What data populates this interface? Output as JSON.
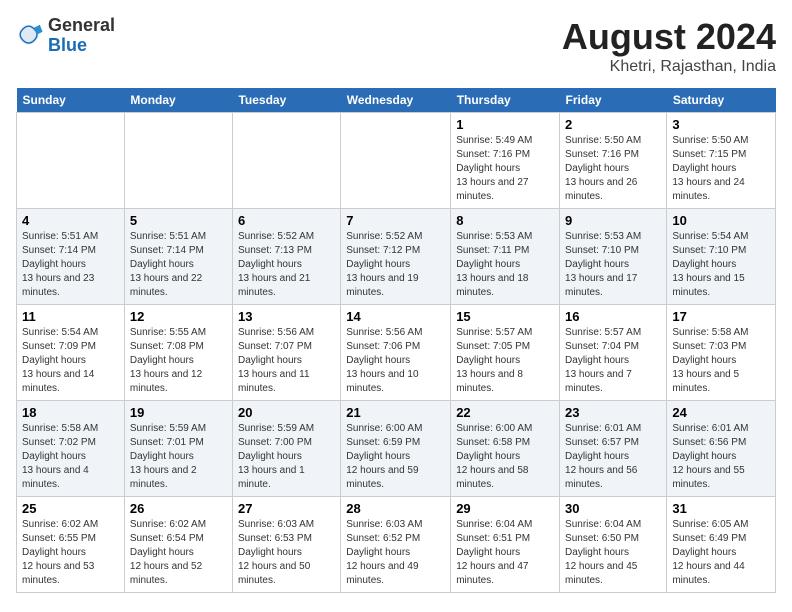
{
  "logo": {
    "general": "General",
    "blue": "Blue"
  },
  "title": "August 2024",
  "subtitle": "Khetri, Rajasthan, India",
  "days_of_week": [
    "Sunday",
    "Monday",
    "Tuesday",
    "Wednesday",
    "Thursday",
    "Friday",
    "Saturday"
  ],
  "weeks": [
    {
      "cells": [
        {
          "day": null
        },
        {
          "day": null
        },
        {
          "day": null
        },
        {
          "day": null
        },
        {
          "day": 1,
          "sunrise": "5:49 AM",
          "sunset": "7:16 PM",
          "daylight": "13 hours and 27 minutes."
        },
        {
          "day": 2,
          "sunrise": "5:50 AM",
          "sunset": "7:16 PM",
          "daylight": "13 hours and 26 minutes."
        },
        {
          "day": 3,
          "sunrise": "5:50 AM",
          "sunset": "7:15 PM",
          "daylight": "13 hours and 24 minutes."
        }
      ]
    },
    {
      "cells": [
        {
          "day": 4,
          "sunrise": "5:51 AM",
          "sunset": "7:14 PM",
          "daylight": "13 hours and 23 minutes."
        },
        {
          "day": 5,
          "sunrise": "5:51 AM",
          "sunset": "7:14 PM",
          "daylight": "13 hours and 22 minutes."
        },
        {
          "day": 6,
          "sunrise": "5:52 AM",
          "sunset": "7:13 PM",
          "daylight": "13 hours and 21 minutes."
        },
        {
          "day": 7,
          "sunrise": "5:52 AM",
          "sunset": "7:12 PM",
          "daylight": "13 hours and 19 minutes."
        },
        {
          "day": 8,
          "sunrise": "5:53 AM",
          "sunset": "7:11 PM",
          "daylight": "13 hours and 18 minutes."
        },
        {
          "day": 9,
          "sunrise": "5:53 AM",
          "sunset": "7:10 PM",
          "daylight": "13 hours and 17 minutes."
        },
        {
          "day": 10,
          "sunrise": "5:54 AM",
          "sunset": "7:10 PM",
          "daylight": "13 hours and 15 minutes."
        }
      ]
    },
    {
      "cells": [
        {
          "day": 11,
          "sunrise": "5:54 AM",
          "sunset": "7:09 PM",
          "daylight": "13 hours and 14 minutes."
        },
        {
          "day": 12,
          "sunrise": "5:55 AM",
          "sunset": "7:08 PM",
          "daylight": "13 hours and 12 minutes."
        },
        {
          "day": 13,
          "sunrise": "5:56 AM",
          "sunset": "7:07 PM",
          "daylight": "13 hours and 11 minutes."
        },
        {
          "day": 14,
          "sunrise": "5:56 AM",
          "sunset": "7:06 PM",
          "daylight": "13 hours and 10 minutes."
        },
        {
          "day": 15,
          "sunrise": "5:57 AM",
          "sunset": "7:05 PM",
          "daylight": "13 hours and 8 minutes."
        },
        {
          "day": 16,
          "sunrise": "5:57 AM",
          "sunset": "7:04 PM",
          "daylight": "13 hours and 7 minutes."
        },
        {
          "day": 17,
          "sunrise": "5:58 AM",
          "sunset": "7:03 PM",
          "daylight": "13 hours and 5 minutes."
        }
      ]
    },
    {
      "cells": [
        {
          "day": 18,
          "sunrise": "5:58 AM",
          "sunset": "7:02 PM",
          "daylight": "13 hours and 4 minutes."
        },
        {
          "day": 19,
          "sunrise": "5:59 AM",
          "sunset": "7:01 PM",
          "daylight": "13 hours and 2 minutes."
        },
        {
          "day": 20,
          "sunrise": "5:59 AM",
          "sunset": "7:00 PM",
          "daylight": "13 hours and 1 minute."
        },
        {
          "day": 21,
          "sunrise": "6:00 AM",
          "sunset": "6:59 PM",
          "daylight": "12 hours and 59 minutes."
        },
        {
          "day": 22,
          "sunrise": "6:00 AM",
          "sunset": "6:58 PM",
          "daylight": "12 hours and 58 minutes."
        },
        {
          "day": 23,
          "sunrise": "6:01 AM",
          "sunset": "6:57 PM",
          "daylight": "12 hours and 56 minutes."
        },
        {
          "day": 24,
          "sunrise": "6:01 AM",
          "sunset": "6:56 PM",
          "daylight": "12 hours and 55 minutes."
        }
      ]
    },
    {
      "cells": [
        {
          "day": 25,
          "sunrise": "6:02 AM",
          "sunset": "6:55 PM",
          "daylight": "12 hours and 53 minutes."
        },
        {
          "day": 26,
          "sunrise": "6:02 AM",
          "sunset": "6:54 PM",
          "daylight": "12 hours and 52 minutes."
        },
        {
          "day": 27,
          "sunrise": "6:03 AM",
          "sunset": "6:53 PM",
          "daylight": "12 hours and 50 minutes."
        },
        {
          "day": 28,
          "sunrise": "6:03 AM",
          "sunset": "6:52 PM",
          "daylight": "12 hours and 49 minutes."
        },
        {
          "day": 29,
          "sunrise": "6:04 AM",
          "sunset": "6:51 PM",
          "daylight": "12 hours and 47 minutes."
        },
        {
          "day": 30,
          "sunrise": "6:04 AM",
          "sunset": "6:50 PM",
          "daylight": "12 hours and 45 minutes."
        },
        {
          "day": 31,
          "sunrise": "6:05 AM",
          "sunset": "6:49 PM",
          "daylight": "12 hours and 44 minutes."
        }
      ]
    }
  ]
}
